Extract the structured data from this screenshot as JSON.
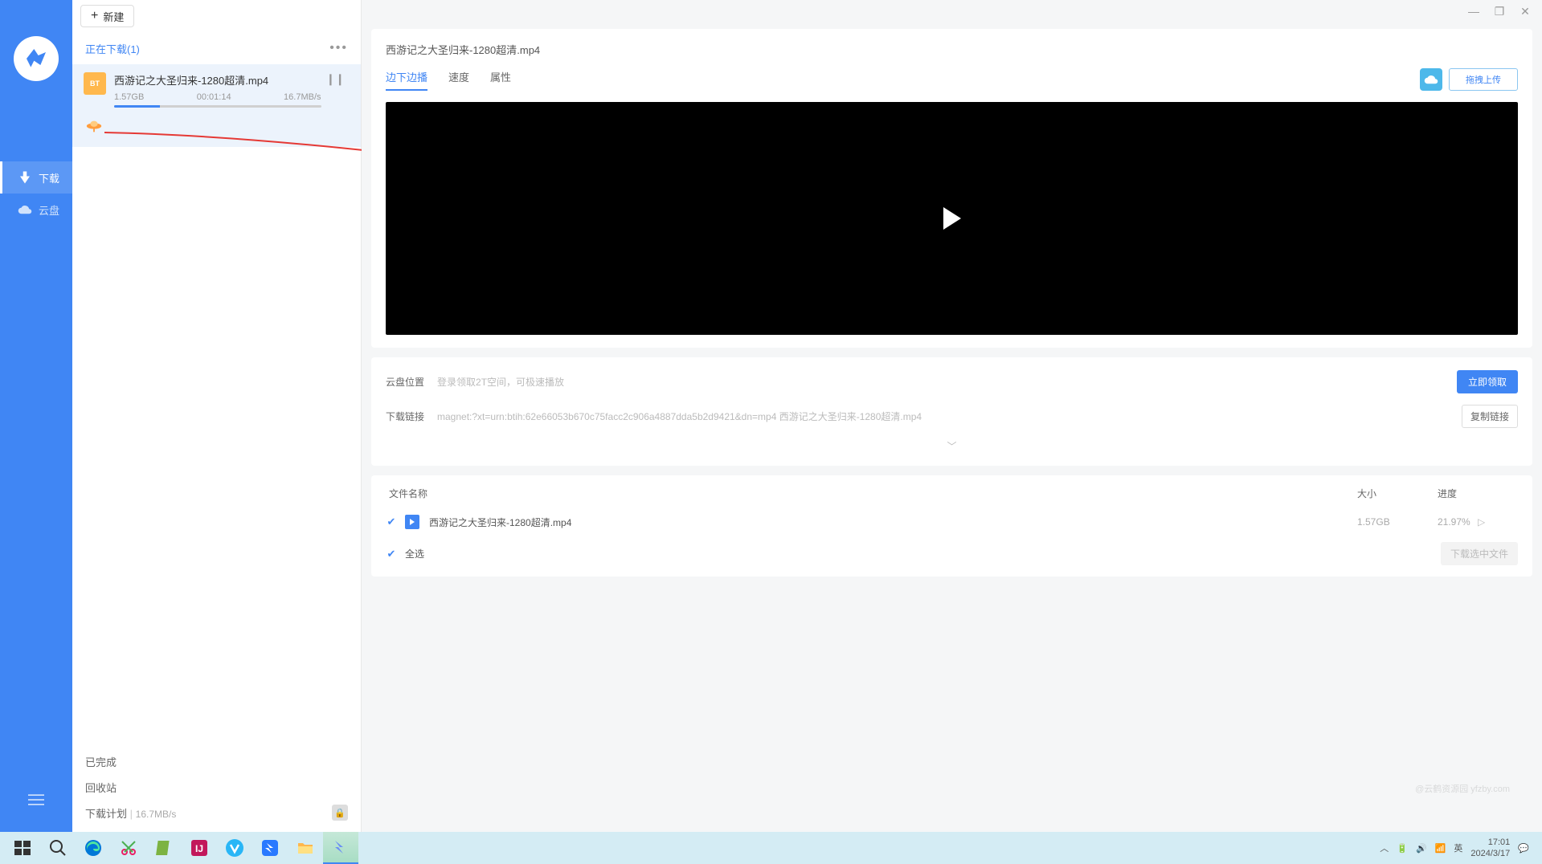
{
  "sidebar": {
    "download_label": "下载",
    "cloud_label": "云盘"
  },
  "middle": {
    "new_button": "新建",
    "tab_title": "正在下载(1)",
    "download": {
      "name": "西游记之大圣归来-1280超清.mp4",
      "size": "1.57GB",
      "time_remaining": "00:01:14",
      "speed": "16.7MB/s"
    },
    "completed": "已完成",
    "recycle": "回收站",
    "plan": "下载计划",
    "plan_speed": "16.7MB/s"
  },
  "detail": {
    "title": "西游记之大圣归来-1280超清.mp4",
    "tabs": {
      "play_download": "边下边播",
      "speed": "速度",
      "properties": "属性"
    },
    "drag_upload": "拖拽上传",
    "cloud_location_label": "云盘位置",
    "cloud_location_hint": "登录领取2T空间，可极速播放",
    "claim_now": "立即领取",
    "download_link_label": "下载链接",
    "download_link_value": "magnet:?xt=urn:btih:62e66053b670c75facc2c906a4887dda5b2d9421&dn=mp4 西游记之大圣归来-1280超清.mp4",
    "copy_link": "复制链接",
    "file_table": {
      "col_name": "文件名称",
      "col_size": "大小",
      "col_progress": "进度",
      "rows": [
        {
          "name": "西游记之大圣归来-1280超清.mp4",
          "size": "1.57GB",
          "progress": "21.97%"
        }
      ],
      "select_all": "全选",
      "download_selected": "下载选中文件"
    }
  },
  "taskbar": {
    "time": "17:01",
    "date": "2024/3/17",
    "ime": "英"
  },
  "watermark": "@云鹤资源园 yfzby.com"
}
